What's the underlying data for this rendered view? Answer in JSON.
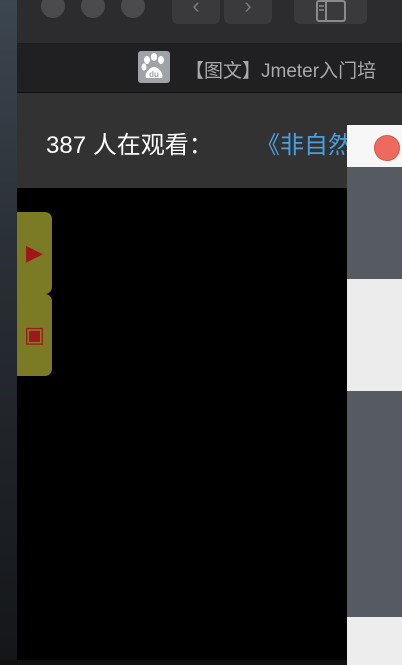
{
  "browser": {
    "tab": {
      "favicon": "baidu-du",
      "title": "【图文】Jmeter入门培"
    },
    "nav_back": "‹",
    "nav_forward": "›"
  },
  "viewer_bar": {
    "count_text": "387 人在观看：",
    "link_text": "《非自然死"
  },
  "controls": {
    "play_glyph": "▶",
    "stop_glyph": "▣"
  },
  "colors": {
    "control_bg": "#7b7a25",
    "control_icon": "#a0161a",
    "link": "#4aa0de",
    "popup_close": "#ee6a5f"
  }
}
